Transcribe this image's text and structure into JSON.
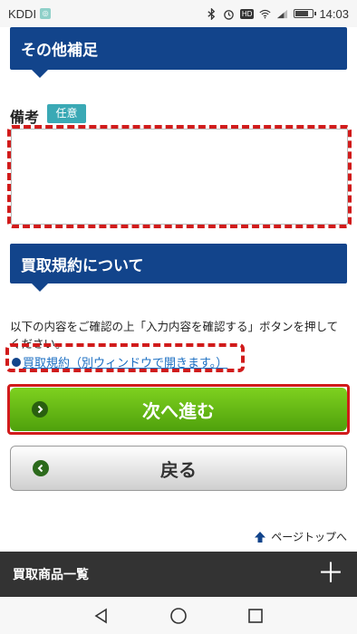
{
  "status_bar": {
    "carrier": "KDDI",
    "time": "14:03",
    "battery_level": 0.7
  },
  "sections": {
    "other": {
      "title": "その他補足"
    },
    "terms": {
      "title": "買取規約について"
    }
  },
  "remarks": {
    "label": "備考",
    "badge": "任意",
    "value": ""
  },
  "agreement_text": "以下の内容をご確認の上「入力内容を確認する」ボタンを押してください。",
  "terms_link": "買取規約（別ウィンドウで開きます。）",
  "buttons": {
    "next": "次へ進む",
    "back": "戻る"
  },
  "page_top": "ページトップへ",
  "bottom_bar": {
    "title": "買取商品一覧"
  },
  "icons": [
    "bluetooth-icon",
    "alarm-icon",
    "wifi-icon",
    "signal-icon",
    "battery-icon",
    "chevron-right-icon",
    "chevron-left-icon",
    "up-arrow-icon",
    "plus-icon",
    "back-nav-icon",
    "home-nav-icon",
    "recents-nav-icon"
  ],
  "colors": {
    "header_blue": "#12448b",
    "badge_teal": "#3aa9b5",
    "next_green": "#5cb412",
    "highlight_red": "#d11b1b",
    "link_blue": "#1a6ec2"
  }
}
